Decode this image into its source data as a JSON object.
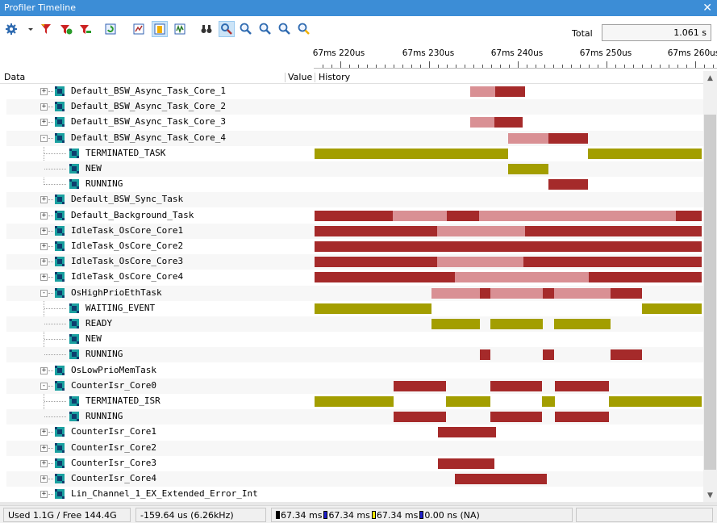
{
  "window": {
    "title": "Profiler Timeline",
    "close_glyph": "✕"
  },
  "toolbar": {
    "icons": [
      "gear-icon",
      "dropdown-arrow-icon",
      "filter-icon",
      "filter-add-icon",
      "filter-remove-icon",
      "refresh-icon",
      "signal-icon",
      "highlight-icon",
      "waveform-icon",
      "binoculars-icon",
      "find-next-icon",
      "zoom-in-icon",
      "zoom-out-icon",
      "zoom-fit-icon",
      "zoom-reset-icon"
    ],
    "active_icons": [
      "highlight-icon",
      "find-next-icon"
    ],
    "total_label": "Total",
    "total_value": "1.061 s"
  },
  "ruler": {
    "ticks": [
      "67ms 220us",
      "67ms 230us",
      "67ms 240us",
      "67ms 250us",
      "67ms 260us"
    ]
  },
  "columns": {
    "data": "Data",
    "value": "Value",
    "history": "History"
  },
  "colors": {
    "running": "#a52a2a",
    "ready": "#d99094",
    "waiting": "#a39e00",
    "title_bar": "#3c8dd6",
    "node_icon": "#1aa0a0"
  },
  "rows": [
    {
      "label": "Default_BSW_Async_Task_Core_1",
      "level": 0,
      "exp": "+",
      "segs": [
        [
          583,
          614,
          "ready"
        ],
        [
          614,
          651,
          "running"
        ]
      ]
    },
    {
      "label": "Default_BSW_Async_Task_Core_2",
      "level": 0,
      "exp": "+",
      "segs": []
    },
    {
      "label": "Default_BSW_Async_Task_Core_3",
      "level": 0,
      "exp": "+",
      "segs": [
        [
          583,
          613,
          "ready"
        ],
        [
          613,
          648,
          "running"
        ]
      ]
    },
    {
      "label": "Default_BSW_Async_Task_Core_4",
      "level": 0,
      "exp": "-",
      "segs": [
        [
          630,
          680,
          "ready"
        ],
        [
          680,
          729,
          "running"
        ]
      ]
    },
    {
      "label": "TERMINATED_TASK",
      "level": 1,
      "segs": [
        [
          390,
          630,
          "waiting"
        ],
        [
          729,
          870,
          "waiting"
        ]
      ]
    },
    {
      "label": "NEW",
      "level": 1,
      "segs": [
        [
          630,
          680,
          "waiting"
        ]
      ]
    },
    {
      "label": "RUNNING",
      "level": 1,
      "segs": [
        [
          680,
          729,
          "running"
        ]
      ]
    },
    {
      "label": "Default_BSW_Sync_Task",
      "level": 0,
      "exp": "+",
      "segs": []
    },
    {
      "label": "Default_Background_Task",
      "level": 0,
      "exp": "+",
      "segs": [
        [
          390,
          487,
          "running"
        ],
        [
          487,
          554,
          "ready"
        ],
        [
          554,
          594,
          "running"
        ],
        [
          594,
          838,
          "ready"
        ],
        [
          838,
          870,
          "running"
        ]
      ]
    },
    {
      "label": "IdleTask_OsCore_Core1",
      "level": 0,
      "exp": "+",
      "segs": [
        [
          390,
          542,
          "running"
        ],
        [
          542,
          651,
          "ready"
        ],
        [
          651,
          870,
          "running"
        ]
      ]
    },
    {
      "label": "IdleTask_OsCore_Core2",
      "level": 0,
      "exp": "+",
      "segs": [
        [
          390,
          870,
          "running"
        ]
      ]
    },
    {
      "label": "IdleTask_OsCore_Core3",
      "level": 0,
      "exp": "+",
      "segs": [
        [
          390,
          542,
          "running"
        ],
        [
          542,
          649,
          "ready"
        ],
        [
          649,
          870,
          "running"
        ]
      ]
    },
    {
      "label": "IdleTask_OsCore_Core4",
      "level": 0,
      "exp": "+",
      "segs": [
        [
          390,
          564,
          "running"
        ],
        [
          564,
          730,
          "ready"
        ],
        [
          730,
          870,
          "running"
        ]
      ]
    },
    {
      "label": "OsHighPrioEthTask",
      "level": 0,
      "exp": "-",
      "segs": [
        [
          535,
          595,
          "ready"
        ],
        [
          595,
          608,
          "running"
        ],
        [
          608,
          673,
          "ready"
        ],
        [
          673,
          687,
          "running"
        ],
        [
          687,
          757,
          "ready"
        ],
        [
          757,
          796,
          "running"
        ]
      ]
    },
    {
      "label": "WAITING_EVENT",
      "level": 1,
      "segs": [
        [
          390,
          535,
          "waiting"
        ],
        [
          796,
          870,
          "waiting"
        ]
      ]
    },
    {
      "label": "READY",
      "level": 1,
      "segs": [
        [
          535,
          595,
          "waiting"
        ],
        [
          608,
          673,
          "waiting"
        ],
        [
          687,
          757,
          "waiting"
        ]
      ]
    },
    {
      "label": "NEW",
      "level": 1,
      "segs": []
    },
    {
      "label": "RUNNING",
      "level": 1,
      "segs": [
        [
          595,
          608,
          "running"
        ],
        [
          673,
          687,
          "running"
        ],
        [
          757,
          796,
          "running"
        ]
      ]
    },
    {
      "label": "OsLowPrioMemTask",
      "level": 0,
      "exp": "+",
      "segs": []
    },
    {
      "label": "CounterIsr_Core0",
      "level": 0,
      "exp": "-",
      "segs": [
        [
          488,
          553,
          "running"
        ],
        [
          608,
          672,
          "running"
        ],
        [
          688,
          755,
          "running"
        ]
      ]
    },
    {
      "label": "TERMINATED_ISR",
      "level": 1,
      "segs": [
        [
          390,
          488,
          "waiting"
        ],
        [
          553,
          608,
          "waiting"
        ],
        [
          672,
          688,
          "waiting"
        ],
        [
          755,
          870,
          "waiting"
        ]
      ]
    },
    {
      "label": "RUNNING",
      "level": 1,
      "segs": [
        [
          488,
          553,
          "running"
        ],
        [
          608,
          672,
          "running"
        ],
        [
          688,
          755,
          "running"
        ]
      ]
    },
    {
      "label": "CounterIsr_Core1",
      "level": 0,
      "exp": "+",
      "segs": [
        [
          543,
          615,
          "running"
        ]
      ]
    },
    {
      "label": "CounterIsr_Core2",
      "level": 0,
      "exp": "+",
      "segs": []
    },
    {
      "label": "CounterIsr_Core3",
      "level": 0,
      "exp": "+",
      "segs": [
        [
          543,
          613,
          "running"
        ]
      ]
    },
    {
      "label": "CounterIsr_Core4",
      "level": 0,
      "exp": "+",
      "segs": [
        [
          564,
          678,
          "running"
        ]
      ]
    },
    {
      "label": "Lin_Channel_1_EX_Extended_Error_Int",
      "level": 0,
      "exp": "+",
      "segs": []
    }
  ],
  "status": {
    "memory": "Used 1.1G / Free 144.4G",
    "delta": "-159.64 us (6.26kHz)",
    "markers": [
      {
        "color": "#000000",
        "text": "67.34 ms"
      },
      {
        "color": "#1f1fcc",
        "text": "67.34 ms"
      },
      {
        "color": "#f2e500",
        "text": "67.34 ms"
      },
      {
        "color": "#1f1fcc",
        "text": "0.00 ns (NA)"
      }
    ]
  }
}
